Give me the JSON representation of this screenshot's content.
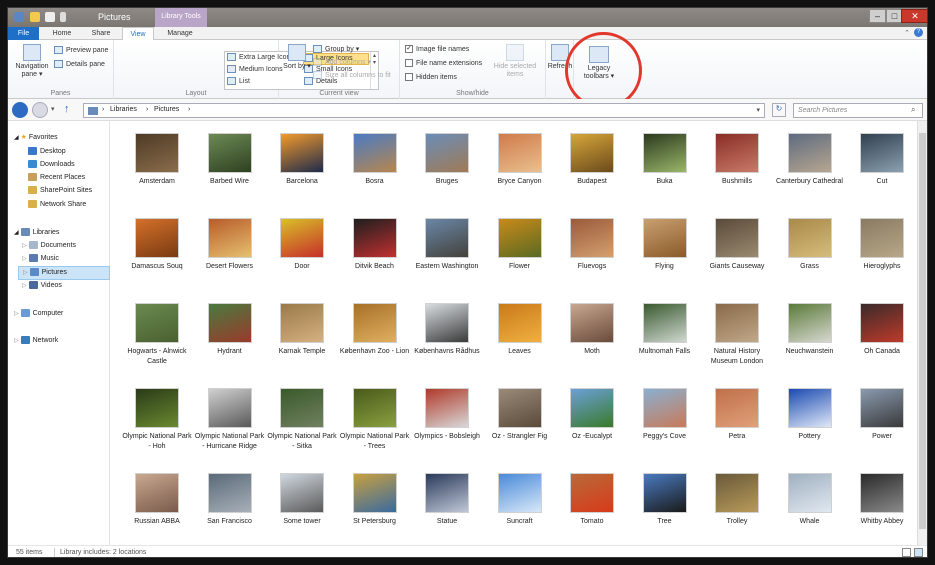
{
  "window": {
    "title": "Pictures",
    "context_tab": "Library Tools",
    "controls": [
      "–",
      "□",
      "✕"
    ]
  },
  "ribbon_tabs": [
    "File",
    "Home",
    "Share",
    "View",
    "Manage"
  ],
  "ribbon": {
    "panes": {
      "navigation_pane": "Navigation pane ▾",
      "preview_pane": "Preview pane",
      "details_pane": "Details pane",
      "label": "Panes"
    },
    "layout": {
      "options": [
        "Extra Large Icons",
        "Large Icons",
        "Medium Icons",
        "Small Icons",
        "List",
        "Details"
      ],
      "selected": "Large Icons",
      "label": "Layout"
    },
    "current_view": {
      "sort": "Sort by ▾",
      "group_by": "Group by ▾",
      "add_columns": "Add columns ▾",
      "size_columns": "Size all columns to fit",
      "label": "Current view"
    },
    "show_hide": {
      "item_checkboxes": "Image file names",
      "file_name_extensions": "File name extensions",
      "hidden_items": "Hidden items",
      "hide_selected": "Hide selected items",
      "label": "Show/hide",
      "checked": [
        true,
        false,
        false
      ]
    },
    "refresh": "Refresh",
    "legacy": "Legacy toolbars ▾"
  },
  "address": {
    "path": [
      "Libraries",
      "Pictures"
    ],
    "search_placeholder": "Search Pictures"
  },
  "nav": {
    "favorites": {
      "label": "Favorites",
      "items": [
        "Desktop",
        "Downloads",
        "Recent Places",
        "SharePoint Sites",
        "Network Share"
      ]
    },
    "libraries": {
      "label": "Libraries",
      "items": [
        "Documents",
        "Music",
        "Pictures",
        "Videos"
      ],
      "selected": "Pictures"
    },
    "computer": "Computer",
    "network": "Network"
  },
  "files": [
    {
      "name": "Amsterdam",
      "c": [
        "#4e3a25",
        "#8a6d4c"
      ]
    },
    {
      "name": "Barbed Wire",
      "c": [
        "#6c8a55",
        "#2e4020"
      ]
    },
    {
      "name": "Barcelona",
      "c": [
        "#f29a2d",
        "#1e2a4a"
      ]
    },
    {
      "name": "Bosra",
      "c": [
        "#4a7bc3",
        "#b8864e"
      ]
    },
    {
      "name": "Bruges",
      "c": [
        "#6a8db8",
        "#a07a55"
      ]
    },
    {
      "name": "Bryce Canyon",
      "c": [
        "#d17a4a",
        "#e9c08f"
      ]
    },
    {
      "name": "Budapest",
      "c": [
        "#d6a63a",
        "#6b4a1c"
      ]
    },
    {
      "name": "Buka",
      "c": [
        "#2b3a1e",
        "#9bb66a"
      ]
    },
    {
      "name": "Bushmills",
      "c": [
        "#8a2e25",
        "#c87a6a"
      ]
    },
    {
      "name": "Canterbury Cathedral",
      "c": [
        "#5e6b80",
        "#b7a690"
      ]
    },
    {
      "name": "Cut",
      "c": [
        "#324050",
        "#8aa0b0"
      ]
    },
    {
      "name": "Damascus Souq",
      "c": [
        "#d4702a",
        "#7a3a12"
      ]
    },
    {
      "name": "Desert Flowers",
      "c": [
        "#b85c2a",
        "#e5c070"
      ]
    },
    {
      "name": "Door",
      "c": [
        "#d9c028",
        "#c62e2a"
      ]
    },
    {
      "name": "Ditvik Beach",
      "c": [
        "#1e1e1e",
        "#c23030"
      ]
    },
    {
      "name": "Eastern Washington",
      "c": [
        "#6a87a8",
        "#44413a"
      ]
    },
    {
      "name": "Flower",
      "c": [
        "#c98a1a",
        "#5a6a22"
      ]
    },
    {
      "name": "Fluevogs",
      "c": [
        "#9a5a3a",
        "#d4a070"
      ]
    },
    {
      "name": "Flying",
      "c": [
        "#c9a070",
        "#8a5a2a"
      ]
    },
    {
      "name": "Giants Causeway",
      "c": [
        "#5a4a3a",
        "#9a8a70"
      ]
    },
    {
      "name": "Grass",
      "c": [
        "#a88a4a",
        "#d6bc7a"
      ]
    },
    {
      "name": "Hieroglyphs",
      "c": [
        "#8a7a62",
        "#b8a888"
      ]
    },
    {
      "name": "Hogwarts - Alnwick Castle",
      "c": [
        "#6a8a50",
        "#4a6030"
      ]
    },
    {
      "name": "Hydrant",
      "c": [
        "#4a7a40",
        "#9a3a2a"
      ]
    },
    {
      "name": "Karnak Temple",
      "c": [
        "#9a7a4a",
        "#d6b080"
      ]
    },
    {
      "name": "København Zoo - Lion",
      "c": [
        "#a8702a",
        "#e0b060"
      ]
    },
    {
      "name": "Københavns Rådhus",
      "c": [
        "#d8dde0",
        "#3a3a3a"
      ]
    },
    {
      "name": "Leaves",
      "c": [
        "#c97a1a",
        "#f0b040"
      ]
    },
    {
      "name": "Moth",
      "c": [
        "#c8a890",
        "#6a4a3a"
      ]
    },
    {
      "name": "Multnomah Falls",
      "c": [
        "#3a5a30",
        "#d0d8d0"
      ]
    },
    {
      "name": "Natural History Museum London",
      "c": [
        "#8a6a4a",
        "#c0a888"
      ]
    },
    {
      "name": "Neuchwanstein",
      "c": [
        "#5a7a3a",
        "#d8d8d0"
      ]
    },
    {
      "name": "Oh Canada",
      "c": [
        "#3a2a2a",
        "#c03a2a"
      ]
    },
    {
      "name": "Olympic National Park - Hoh",
      "c": [
        "#2a3a18",
        "#6a8a30"
      ]
    },
    {
      "name": "Olympic National Park - Hurricane Ridge",
      "c": [
        "#d0d0d0",
        "#5a5a5a"
      ]
    },
    {
      "name": "Olympic National Park - Sitka",
      "c": [
        "#3a5a2a",
        "#708060"
      ]
    },
    {
      "name": "Olympic National Park - Trees",
      "c": [
        "#4a5a1a",
        "#8aa040"
      ]
    },
    {
      "name": "Olympics - Bobsleigh",
      "c": [
        "#b03a2a",
        "#d8d8d8"
      ]
    },
    {
      "name": "Oz - Strangler Fig",
      "c": [
        "#9a8a7a",
        "#5a4a3a"
      ]
    },
    {
      "name": "Oz -Eucalypt",
      "c": [
        "#6aa0d8",
        "#3a7a2a"
      ]
    },
    {
      "name": "Peggy's Cove",
      "c": [
        "#8ab0d0",
        "#c87a5a"
      ]
    },
    {
      "name": "Petra",
      "c": [
        "#c0704a",
        "#e0a07a"
      ]
    },
    {
      "name": "Pottery",
      "c": [
        "#1a4ab0",
        "#e0e8f8"
      ]
    },
    {
      "name": "Power",
      "c": [
        "#8a9ab0",
        "#3a3a3a"
      ]
    },
    {
      "name": "Russian ABBA",
      "c": [
        "#c8a890",
        "#7a5a4a"
      ]
    },
    {
      "name": "San Francisco",
      "c": [
        "#5a6a7a",
        "#a8b0b8"
      ]
    },
    {
      "name": "Some tower",
      "c": [
        "#d0d8e0",
        "#5a5a5a"
      ]
    },
    {
      "name": "St Petersburg",
      "c": [
        "#c8a040",
        "#3a6aa0"
      ]
    },
    {
      "name": "Statue",
      "c": [
        "#2a3a5a",
        "#c0c8d8"
      ]
    },
    {
      "name": "Suncraft",
      "c": [
        "#4a8ad8",
        "#d8e8f8"
      ]
    },
    {
      "name": "Tomato",
      "c": [
        "#b86a3a",
        "#d83a1a"
      ]
    },
    {
      "name": "Tree",
      "c": [
        "#4a7ac0",
        "#1a1a1a"
      ]
    },
    {
      "name": "Trolley",
      "c": [
        "#6a5a3a",
        "#b89a5a"
      ]
    },
    {
      "name": "Whale",
      "c": [
        "#a0b0c0",
        "#e0e8f0"
      ]
    },
    {
      "name": "Whitby Abbey",
      "c": [
        "#2a2a2a",
        "#8a8a8a"
      ]
    }
  ],
  "status": {
    "count": "55 items",
    "library_info": "Library includes: 2 locations"
  }
}
